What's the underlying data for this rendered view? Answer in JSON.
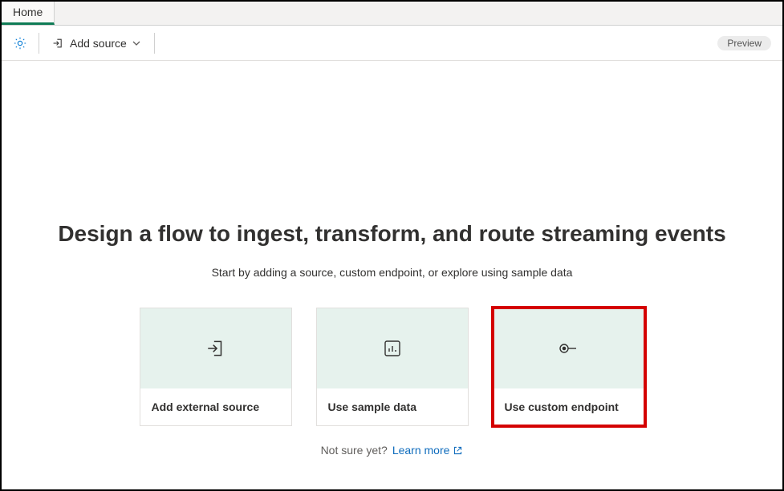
{
  "tab": {
    "label": "Home"
  },
  "toolbar": {
    "add_source_label": "Add source",
    "preview_label": "Preview"
  },
  "hero": {
    "headline": "Design a flow to ingest, transform, and route streaming events",
    "subhead": "Start by adding a source, custom endpoint, or explore using sample data"
  },
  "cards": [
    {
      "label": "Add external source",
      "icon": "enter-icon",
      "highlight": false
    },
    {
      "label": "Use sample data",
      "icon": "bar-chart-icon",
      "highlight": false
    },
    {
      "label": "Use custom endpoint",
      "icon": "endpoint-icon",
      "highlight": true
    }
  ],
  "footer": {
    "prompt": "Not sure yet?",
    "link_label": "Learn more"
  }
}
